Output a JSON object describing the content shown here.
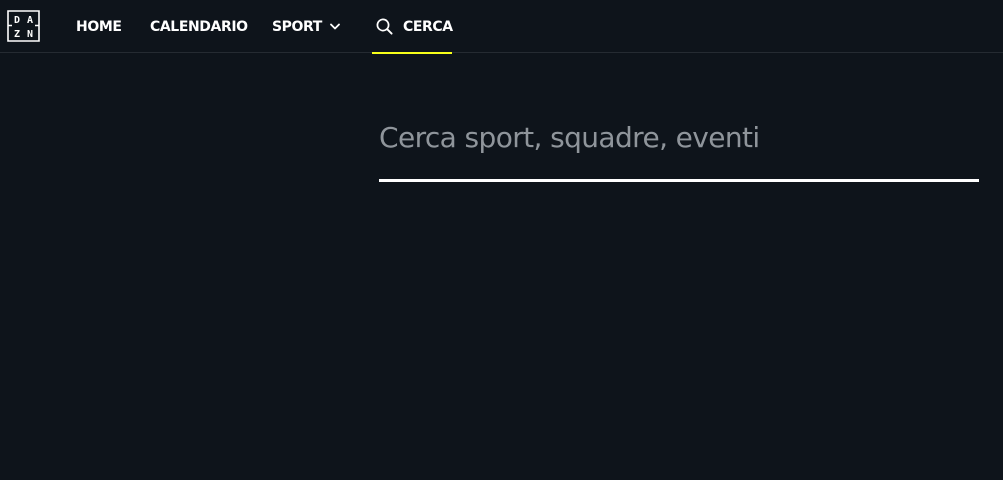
{
  "brand": {
    "logo_letters": [
      "D",
      "A",
      "Z",
      "N"
    ]
  },
  "nav": {
    "home": "HOME",
    "calendar": "CALENDARIO",
    "sport": "SPORT",
    "search": "CERCA",
    "active": "search"
  },
  "icons": {
    "sport_dropdown": "chevron-down-icon",
    "search": "search-icon"
  },
  "search": {
    "value": "",
    "placeholder": "Cerca sport, squadre, eventi"
  },
  "colors": {
    "background": "#0e141b",
    "accent": "#f7ff1a",
    "text": "#ffffff",
    "placeholder": "#8f959b"
  }
}
